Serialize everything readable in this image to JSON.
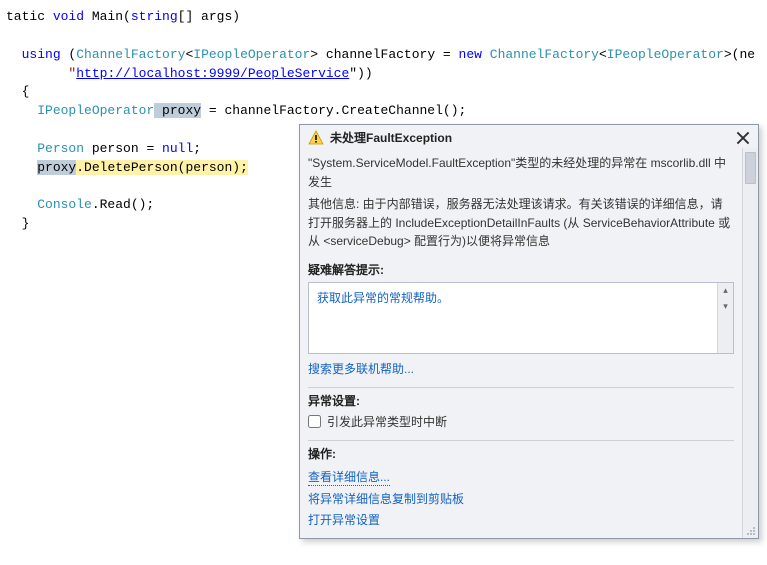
{
  "code": {
    "line0_pre": "tatic ",
    "line0_void": "void",
    "line0_main": " Main(",
    "line0_string": "string",
    "line0_rest": "[] args)",
    "using_kw": "using",
    "open_paren": " (",
    "cf_type": "ChannelFactory",
    "lt": "<",
    "ipeople": "IPeopleOperator",
    "gt": ">",
    "cf_var": " channelFactory = ",
    "new_kw": "new",
    "sp": " ",
    "open_paren2": "(ne",
    "url": "http://localhost:9999/PeopleService",
    "quotes_close": "\"))",
    "brace_open": "{",
    "ipeople_var": " proxy",
    "assign_cc": " = channelFactory.CreateChannel();",
    "person_type": "Person",
    "person_rest": " person = ",
    "null_kw": "null",
    "semi": ";",
    "proxy": "proxy",
    "dot": ".",
    "deleteperson": "DeletePerson(person)",
    "console_type": "Console",
    "console_rest": ".Read();",
    "brace_close": "}"
  },
  "popup": {
    "title_prefix": "未处理",
    "title_exception": "FaultException",
    "close_glyph": "✕",
    "desc_line1": "\"System.ServiceModel.FaultException\"类型的未经处理的异常在 mscorlib.dll 中发生",
    "desc_line2": "其他信息: 由于内部错误，服务器无法处理该请求。有关该错误的详细信息，请打开服务器上的 IncludeExceptionDetailInFaults (从 ServiceBehaviorAttribute 或从 <serviceDebug> 配置行为)以便将异常信息",
    "tips_label": "疑难解答提示:",
    "tip_link": "获取此异常的常规帮助。",
    "search_link": "搜索更多联机帮助...",
    "settings_label": "异常设置:",
    "checkbox_label": "引发此异常类型时中断",
    "actions_label": "操作:",
    "action1": "查看详细信息...",
    "action2": "将异常详细信息复制到剪贴板",
    "action3": "打开异常设置"
  }
}
